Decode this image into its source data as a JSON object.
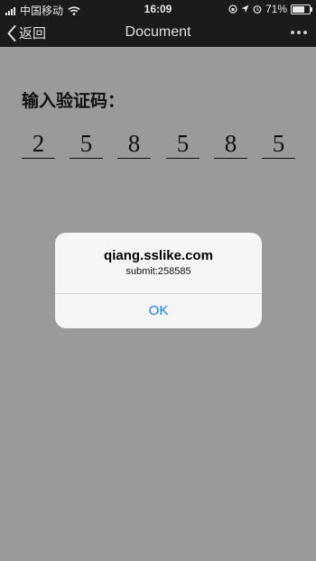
{
  "status_bar": {
    "carrier": "中国移动",
    "time": "16:09",
    "battery_percent": "71%",
    "battery_level": 0.71
  },
  "nav": {
    "back_label": "返回",
    "title": "Document"
  },
  "main": {
    "prompt": "输入验证码：",
    "code_digits": [
      "2",
      "5",
      "8",
      "5",
      "8",
      "5"
    ]
  },
  "alert": {
    "title": "qiang.sslike.com",
    "message": "submit:258585",
    "ok_label": "OK"
  },
  "colors": {
    "background": "#9a9a9a",
    "bar": "#1b1b1b",
    "alert_background": "#f6f6f6",
    "link_blue": "#1a7bf2"
  },
  "icons": {
    "back": "chevron-left-icon",
    "more": "more-dots-icon",
    "wifi": "wifi-icon",
    "signal": "signal-bars-icon",
    "battery": "battery-icon",
    "alarm": "alarm-clock-icon",
    "location": "location-arrow-icon",
    "lock": "orientation-lock-icon"
  }
}
